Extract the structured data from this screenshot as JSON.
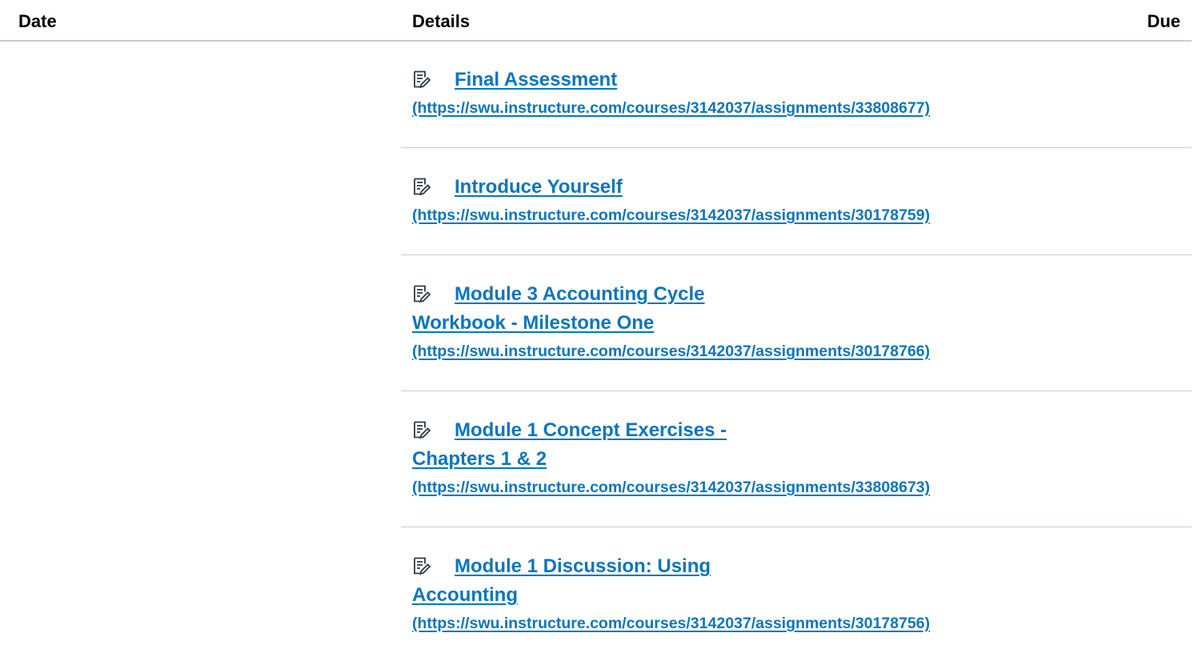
{
  "table": {
    "headers": {
      "date": "Date",
      "details": "Details",
      "due": "Due"
    },
    "rows": [
      {
        "icon": "assignment-icon",
        "title_lines": [
          "Final Assessment"
        ],
        "url": "(https://swu.instructure.com/courses/3142037/assignments/33808677)"
      },
      {
        "icon": "assignment-icon",
        "title_lines": [
          "Introduce Yourself"
        ],
        "url": "(https://swu.instructure.com/courses/3142037/assignments/30178759)"
      },
      {
        "icon": "assignment-icon",
        "title_lines": [
          "Module 3 Accounting Cycle",
          "Workbook - Milestone One"
        ],
        "url": "(https://swu.instructure.com/courses/3142037/assignments/30178766)"
      },
      {
        "icon": "assignment-icon",
        "title_lines": [
          "Module 1 Concept Exercises -",
          "Chapters 1 & 2"
        ],
        "url": "(https://swu.instructure.com/courses/3142037/assignments/33808673)"
      },
      {
        "icon": "assignment-icon",
        "title_lines": [
          "Module 1 Discussion: Using",
          "Accounting"
        ],
        "url": "(https://swu.instructure.com/courses/3142037/assignments/30178756)"
      }
    ]
  },
  "colors": {
    "link": "#0a75bd",
    "header_text": "#000000",
    "divider": "#c7cdd1"
  }
}
